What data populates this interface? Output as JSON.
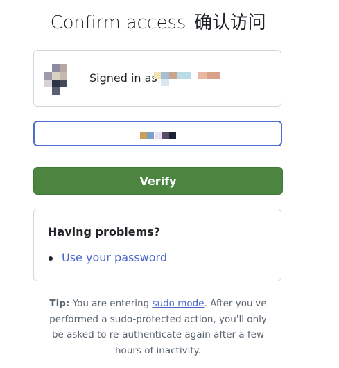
{
  "header": {
    "title": "Confirm access",
    "title_cn": "确认访问"
  },
  "account": {
    "signed_in_label": "Signed in as"
  },
  "form": {
    "verify_label": "Verify"
  },
  "problems": {
    "title": "Having problems?",
    "link_label": "Use your password"
  },
  "tip": {
    "label": "Tip:",
    "text_before": "You are entering",
    "link": "sudo mode",
    "text_after": ". After you've performed a sudo-protected action, you'll only be asked to re-authenticate again after a few hours of inactivity."
  },
  "colors": {
    "primary_button": "#4b8540",
    "link": "#4a66c9",
    "input_focus_border": "#4a6fd1",
    "card_border": "#d0d7de"
  }
}
